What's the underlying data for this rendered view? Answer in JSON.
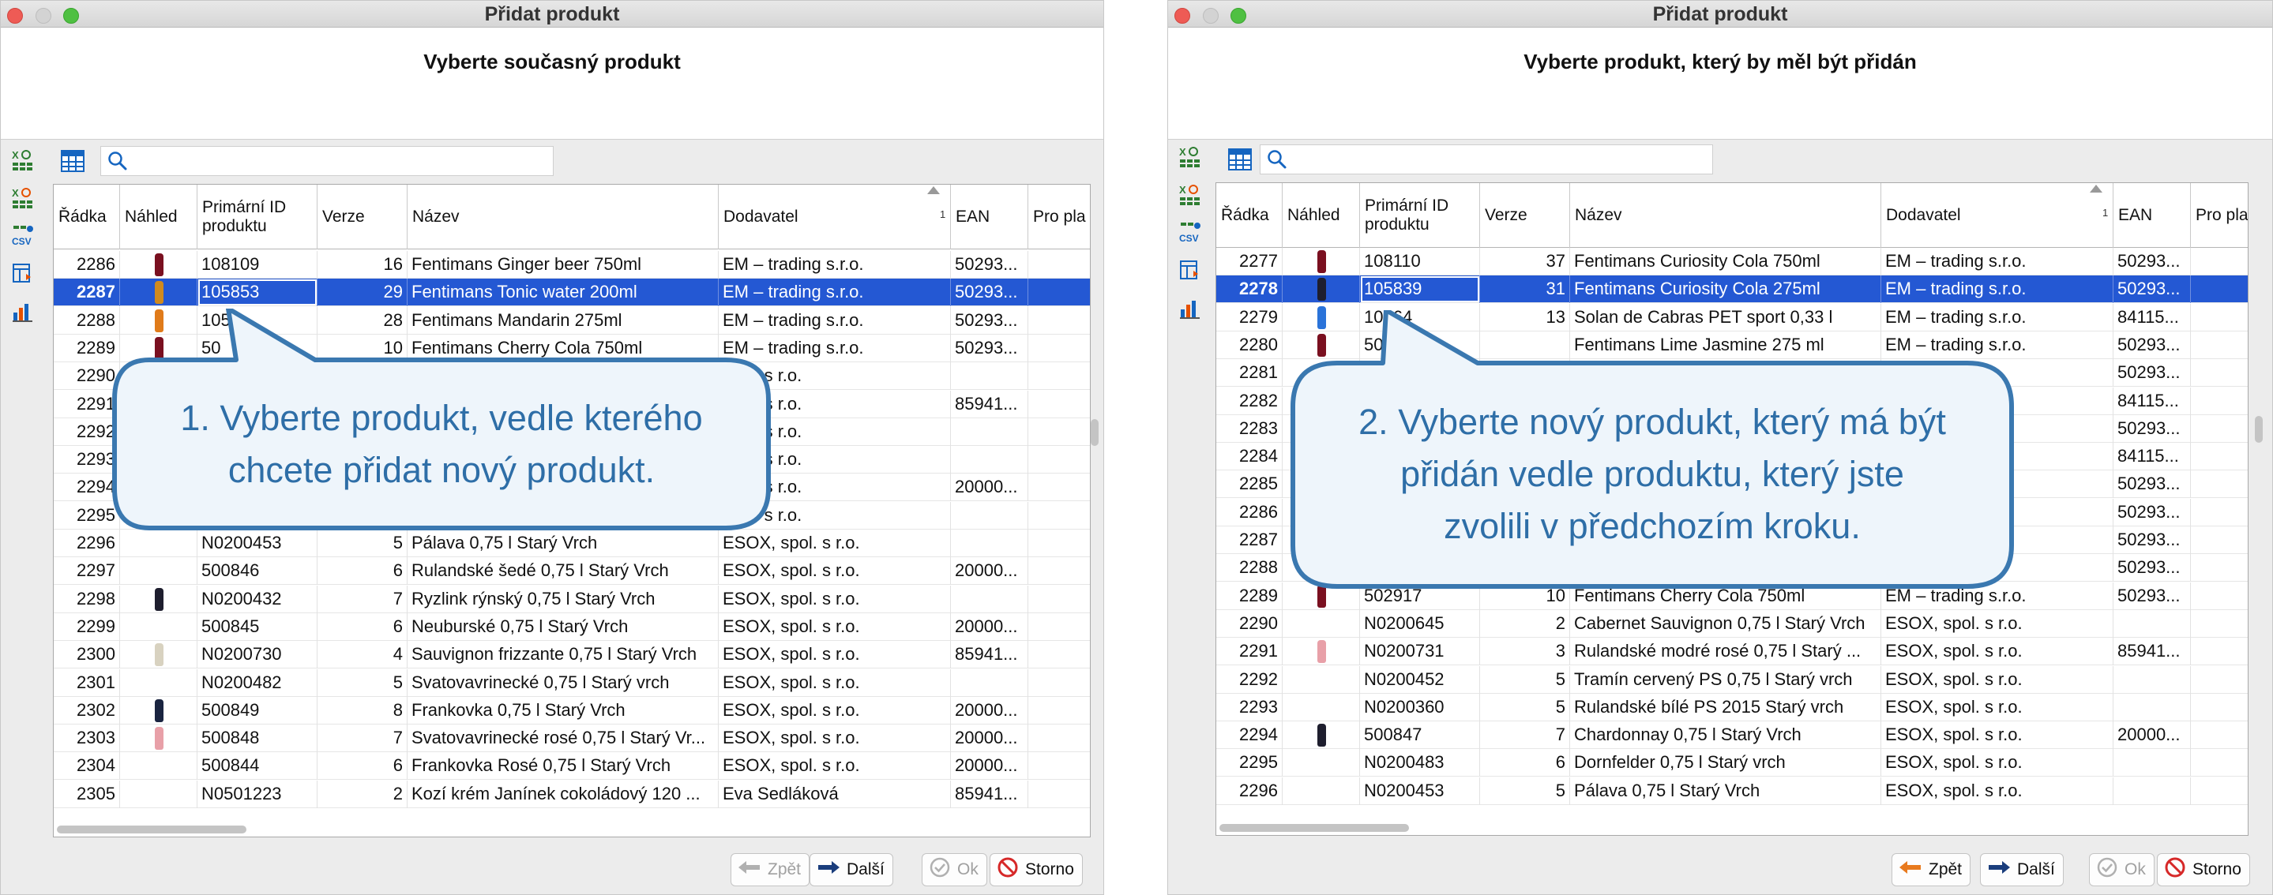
{
  "colors": {
    "selection": "#2458d3",
    "callout_border": "#3a78b0",
    "callout_text": "#2e6ea7",
    "callout_fill": "#eef5fb"
  },
  "left": {
    "window_title": "Přidat produkt",
    "heading": "Vyberte současný produkt",
    "search_placeholder": "",
    "columns": [
      "Řádka",
      "Náhled",
      "Primární ID produktu",
      "Verze",
      "Název",
      "Dodavatel",
      "EAN",
      "Pro pla"
    ],
    "sort_marker": "1",
    "rows": [
      {
        "radka": "2286",
        "preview": "bottle-red",
        "id": "108109",
        "verze": "16",
        "nazev": "Fentimans Ginger beer 750ml",
        "dodavatel": "EM – trading s.r.o.",
        "ean": "50293..."
      },
      {
        "radka": "2287",
        "preview": "bottle-amber",
        "id": "105853",
        "verze": "29",
        "nazev": "Fentimans Tonic water 200ml",
        "dodavatel": "EM – trading s.r.o.",
        "ean": "50293...",
        "selected": true
      },
      {
        "radka": "2288",
        "preview": "bottle-orange",
        "id": "105",
        "verze": "28",
        "nazev": "Fentimans Mandarin 275ml",
        "dodavatel": "EM – trading s.r.o.",
        "ean": "50293..."
      },
      {
        "radka": "2289",
        "preview": "bottle-red",
        "id": "50",
        "verze": "10",
        "nazev": "Fentimans Cherry Cola 750ml",
        "dodavatel": "EM – trading s.r.o.",
        "ean": "50293..."
      },
      {
        "radka": "2290",
        "preview": "",
        "id": "",
        "verze": "",
        "nazev": "",
        "dodavatel": "spol. s r.o.",
        "ean": ""
      },
      {
        "radka": "2291",
        "preview": "",
        "id": "",
        "verze": "",
        "nazev": "",
        "dodavatel": "spol. s r.o.",
        "ean": "85941..."
      },
      {
        "radka": "2292",
        "preview": "",
        "id": "",
        "verze": "",
        "nazev": "",
        "dodavatel": "spol. s r.o.",
        "ean": ""
      },
      {
        "radka": "2293",
        "preview": "",
        "id": "",
        "verze": "",
        "nazev": "",
        "dodavatel": "spol. s r.o.",
        "ean": ""
      },
      {
        "radka": "2294",
        "preview": "",
        "id": "",
        "verze": "",
        "nazev": "",
        "dodavatel": "spol. s r.o.",
        "ean": "20000..."
      },
      {
        "radka": "2295",
        "preview": "",
        "id": "",
        "verze": "",
        "nazev": "",
        "dodavatel": "spol. s r.o.",
        "ean": ""
      },
      {
        "radka": "2296",
        "preview": "",
        "id": "N0200453",
        "verze": "5",
        "nazev": "Pálava 0,75 l Starý Vrch",
        "dodavatel": "ESOX, spol. s r.o.",
        "ean": ""
      },
      {
        "radka": "2297",
        "preview": "",
        "id": "500846",
        "verze": "6",
        "nazev": "Rulandské šedé 0,75 l Starý Vrch",
        "dodavatel": "ESOX, spol. s r.o.",
        "ean": "20000..."
      },
      {
        "radka": "2298",
        "preview": "bottle-dark",
        "id": "N0200432",
        "verze": "7",
        "nazev": "Ryzlink rýnský 0,75 l Starý Vrch",
        "dodavatel": "ESOX, spol. s r.o.",
        "ean": ""
      },
      {
        "radka": "2299",
        "preview": "",
        "id": "500845",
        "verze": "6",
        "nazev": "Neuburské 0,75 l Starý Vrch",
        "dodavatel": "ESOX, spol. s r.o.",
        "ean": "20000..."
      },
      {
        "radka": "2300",
        "preview": "bottle-light",
        "id": "N0200730",
        "verze": "4",
        "nazev": "Sauvignon frizzante 0,75 l Starý Vrch",
        "dodavatel": "ESOX, spol. s r.o.",
        "ean": "85941..."
      },
      {
        "radka": "2301",
        "preview": "",
        "id": "N0200482",
        "verze": "5",
        "nazev": "Svatovavrinecké 0,75 l Starý vrch",
        "dodavatel": "ESOX, spol. s r.o.",
        "ean": ""
      },
      {
        "radka": "2302",
        "preview": "bottle-navy",
        "id": "500849",
        "verze": "8",
        "nazev": "Frankovka 0,75 l Starý Vrch",
        "dodavatel": "ESOX, spol. s r.o.",
        "ean": "20000..."
      },
      {
        "radka": "2303",
        "preview": "bottle-pink",
        "id": "500848",
        "verze": "7",
        "nazev": "Svatovavrinecké rosé 0,75 l Starý Vr...",
        "dodavatel": "ESOX, spol. s r.o.",
        "ean": "20000..."
      },
      {
        "radka": "2304",
        "preview": "",
        "id": "500844",
        "verze": "6",
        "nazev": "Frankovka Rosé 0,75 l Starý Vrch",
        "dodavatel": "ESOX, spol. s r.o.",
        "ean": "20000..."
      },
      {
        "radka": "2305",
        "preview": "",
        "id": "N0501223",
        "verze": "2",
        "nazev": "Kozí krém Janínek cokoládový 120 ...",
        "dodavatel": "Eva Sedláková",
        "ean": "85941..."
      }
    ],
    "callout": [
      "1. Vyberte produkt, vedle kterého",
      "chcete přidat nový produkt."
    ],
    "buttons": {
      "back": "Zpět",
      "next": "Další",
      "ok": "Ok",
      "cancel": "Storno"
    }
  },
  "right": {
    "window_title": "Přidat produkt",
    "heading": "Vyberte produkt, který by měl být přidán",
    "search_placeholder": "",
    "columns": [
      "Řádka",
      "Náhled",
      "Primární ID produktu",
      "Verze",
      "Název",
      "Dodavatel",
      "EAN",
      "Pro pla"
    ],
    "sort_marker": "1",
    "rows": [
      {
        "radka": "2277",
        "preview": "bottle-red",
        "id": "108110",
        "verze": "37",
        "nazev": "Fentimans Curiosity Cola 750ml",
        "dodavatel": "EM – trading s.r.o.",
        "ean": "50293..."
      },
      {
        "radka": "2278",
        "preview": "bottle-dark",
        "id": "105839",
        "verze": "31",
        "nazev": "Fentimans Curiosity Cola 275ml",
        "dodavatel": "EM – trading s.r.o.",
        "ean": "50293...",
        "selected": true
      },
      {
        "radka": "2279",
        "preview": "bottle-blue",
        "id": "10864",
        "verze": "13",
        "nazev": "Solan de Cabras PET sport 0,33 l",
        "dodavatel": "EM – trading s.r.o.",
        "ean": "84115..."
      },
      {
        "radka": "2280",
        "preview": "bottle-red",
        "id": "50181",
        "verze": "",
        "nazev": "Fentimans Lime Jasmine 275 ml",
        "dodavatel": "EM – trading s.r.o.",
        "ean": "50293..."
      },
      {
        "radka": "2281",
        "preview": "",
        "id": "",
        "verze": "",
        "nazev": "",
        "dodavatel": "",
        "ean": "50293..."
      },
      {
        "radka": "2282",
        "preview": "",
        "id": "",
        "verze": "",
        "nazev": "",
        "dodavatel": "",
        "ean": "84115..."
      },
      {
        "radka": "2283",
        "preview": "",
        "id": "",
        "verze": "",
        "nazev": "",
        "dodavatel": "",
        "ean": "50293..."
      },
      {
        "radka": "2284",
        "preview": "",
        "id": "",
        "verze": "",
        "nazev": "",
        "dodavatel": "",
        "ean": "84115..."
      },
      {
        "radka": "2285",
        "preview": "",
        "id": "",
        "verze": "",
        "nazev": "",
        "dodavatel": "",
        "ean": "50293..."
      },
      {
        "radka": "2286",
        "preview": "",
        "id": "",
        "verze": "",
        "nazev": "",
        "dodavatel": "",
        "ean": "50293..."
      },
      {
        "radka": "2287",
        "preview": "",
        "id": "",
        "verze": "",
        "nazev": "",
        "dodavatel": "",
        "ean": "50293..."
      },
      {
        "radka": "2288",
        "preview": "",
        "id": "",
        "verze": "",
        "nazev": "",
        "dodavatel": "",
        "ean": "50293..."
      },
      {
        "radka": "2289",
        "preview": "bottle-red",
        "id": "502917",
        "verze": "10",
        "nazev": "Fentimans Cherry Cola 750ml",
        "dodavatel": "EM – trading s.r.o.",
        "ean": "50293..."
      },
      {
        "radka": "2290",
        "preview": "",
        "id": "N0200645",
        "verze": "2",
        "nazev": "Cabernet Sauvignon 0,75 l Starý Vrch",
        "dodavatel": "ESOX, spol. s r.o.",
        "ean": ""
      },
      {
        "radka": "2291",
        "preview": "bottle-pink",
        "id": "N0200731",
        "verze": "3",
        "nazev": "Rulandské modré rosé 0,75 l Starý ...",
        "dodavatel": "ESOX, spol. s r.o.",
        "ean": "85941..."
      },
      {
        "radka": "2292",
        "preview": "",
        "id": "N0200452",
        "verze": "5",
        "nazev": "Tramín cervený PS 0,75 l Starý vrch",
        "dodavatel": "ESOX, spol. s r.o.",
        "ean": ""
      },
      {
        "radka": "2293",
        "preview": "",
        "id": "N0200360",
        "verze": "5",
        "nazev": "Rulandské bílé PS 2015 Starý vrch",
        "dodavatel": "ESOX, spol. s r.o.",
        "ean": ""
      },
      {
        "radka": "2294",
        "preview": "bottle-dark",
        "id": "500847",
        "verze": "7",
        "nazev": "Chardonnay 0,75 l Starý Vrch",
        "dodavatel": "ESOX, spol. s r.o.",
        "ean": "20000..."
      },
      {
        "radka": "2295",
        "preview": "",
        "id": "N0200483",
        "verze": "6",
        "nazev": "Dornfelder 0,75 l Starý vrch",
        "dodavatel": "ESOX, spol. s r.o.",
        "ean": ""
      },
      {
        "radka": "2296",
        "preview": "",
        "id": "N0200453",
        "verze": "5",
        "nazev": "Pálava 0,75 l Starý Vrch",
        "dodavatel": "ESOX, spol. s r.o.",
        "ean": ""
      }
    ],
    "callout": [
      "2. Vyberte nový produkt, který má být",
      "přidán vedle produktu, který jste",
      "zvolili v předchozím kroku."
    ],
    "buttons": {
      "back": "Zpět",
      "next": "Další",
      "ok": "Ok",
      "cancel": "Storno"
    }
  }
}
